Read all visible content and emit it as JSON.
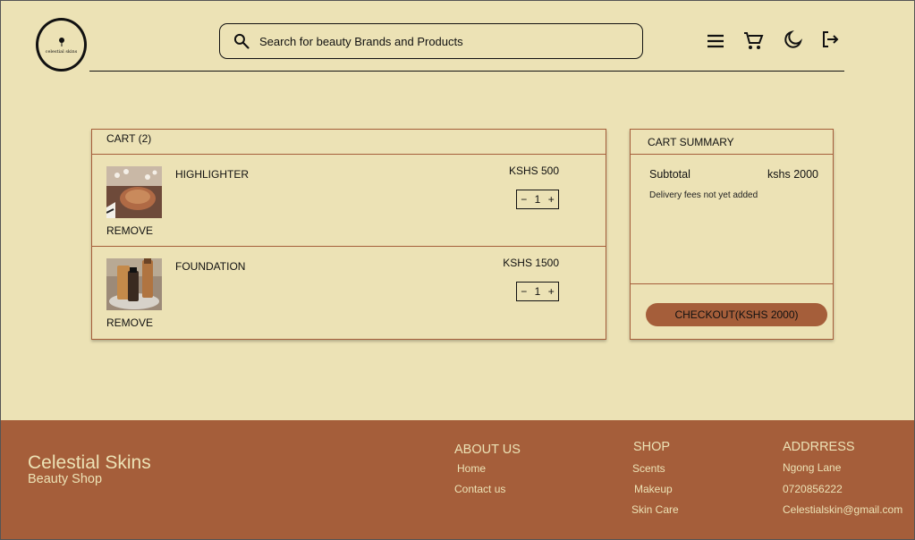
{
  "header": {
    "logo_text": "celestial skins",
    "search_placeholder": "Search for beauty Brands and Products",
    "icons": [
      "menu-icon",
      "cart-icon",
      "moon-icon",
      "logout-icon"
    ]
  },
  "cart": {
    "title": "CART (2)",
    "items": [
      {
        "name": "HIGHLIGHTER",
        "price": "KSHS 500",
        "qty": "1",
        "minus": "−",
        "plus": "+",
        "remove": "REMOVE"
      },
      {
        "name": "FOUNDATION",
        "price": "KSHS 1500",
        "qty": "1",
        "minus": "−",
        "plus": "+",
        "remove": "REMOVE"
      }
    ]
  },
  "summary": {
    "title": "CART SUMMARY",
    "subtotal_label": "Subtotal",
    "subtotal_value": "kshs 2000",
    "delivery_note": "Delivery fees not yet added",
    "checkout_label": "CHECKOUT(KSHS 2000)"
  },
  "footer": {
    "brand": "Celestial Skins",
    "brand_sub": "Beauty Shop",
    "about": {
      "heading": "ABOUT US",
      "links": [
        "Home",
        "Contact us"
      ]
    },
    "shop": {
      "heading": "SHOP",
      "links": [
        "Scents",
        "Makeup",
        "Skin Care"
      ]
    },
    "address": {
      "heading": "ADDRRESS",
      "lines": [
        "Ngong Lane",
        "0720856222",
        "Celestialskin@gmail.com"
      ]
    }
  },
  "colors": {
    "background": "#ece2b5",
    "accent": "#a55e3a"
  }
}
